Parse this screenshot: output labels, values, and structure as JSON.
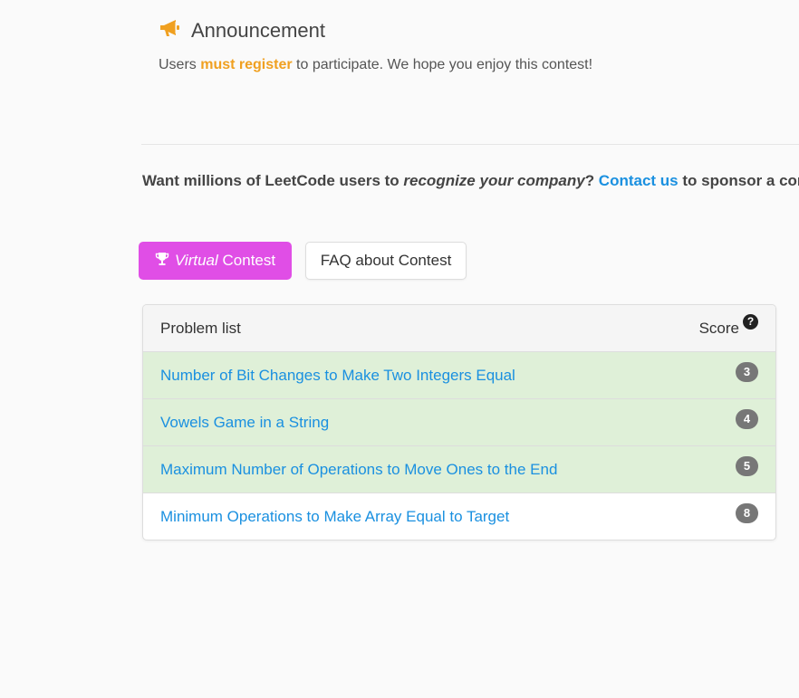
{
  "announcement": {
    "icon": "megaphone-icon",
    "title": "Announcement",
    "text_before": "Users ",
    "text_highlight": "must register",
    "text_after": " to participate. We hope you enjoy this contest!",
    "highlight_color": "#f0a020"
  },
  "sponsor": {
    "part1": "Want millions of LeetCode users to ",
    "emphasis": "recognize your company",
    "part2": "? ",
    "link": "Contact us",
    "part3": " to sponsor a cor",
    "link_color": "#1a90e0"
  },
  "buttons": {
    "virtual_italic": "Virtual",
    "virtual_rest": " Contest",
    "virtual_icon": "trophy-icon",
    "virtual_color": "#e04ee6",
    "faq_label": "FAQ about Contest"
  },
  "problem_list": {
    "header": "Problem list",
    "score_header": "Score",
    "score_help_icon": "question-circle-icon",
    "solved_color": "#dff0d8",
    "rows": [
      {
        "title": "Number of Bit Changes to Make Two Integers Equal",
        "score": "3",
        "solved": true
      },
      {
        "title": "Vowels Game in a String",
        "score": "4",
        "solved": true
      },
      {
        "title": "Maximum Number of Operations to Move Ones to the End",
        "score": "5",
        "solved": true
      },
      {
        "title": "Minimum Operations to Make Array Equal to Target",
        "score": "8",
        "solved": false
      }
    ]
  }
}
